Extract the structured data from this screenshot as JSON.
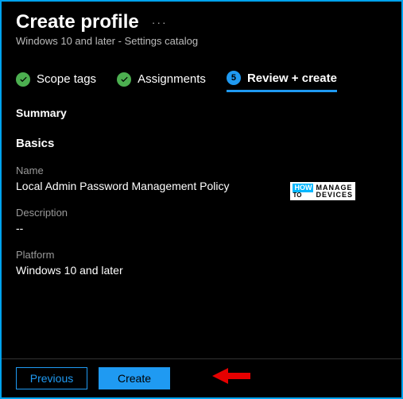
{
  "header": {
    "title": "Create profile",
    "subtitle": "Windows 10 and later - Settings catalog"
  },
  "tabs": {
    "scope": "Scope tags",
    "assignments": "Assignments",
    "step_num": "5",
    "review": "Review + create"
  },
  "summary": {
    "heading": "Summary",
    "basics_heading": "Basics",
    "name_label": "Name",
    "name_value": "Local Admin Password Management Policy",
    "desc_label": "Description",
    "desc_value": "--",
    "platform_label": "Platform",
    "platform_value": "Windows 10 and later"
  },
  "footer": {
    "previous": "Previous",
    "create": "Create"
  },
  "watermark": {
    "how": "HOW",
    "to": "TO",
    "manage": "MANAGE",
    "devices": "DEVICES"
  }
}
